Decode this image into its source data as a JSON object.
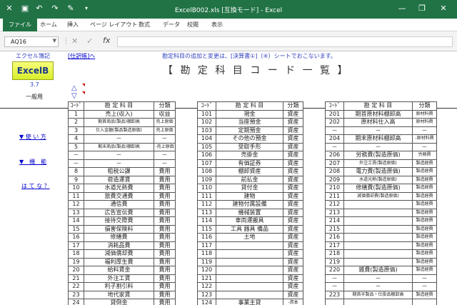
{
  "app": {
    "title": "ExcelB002.xls [互換モード] - Excel",
    "quick_access": {
      "undo": "↶",
      "redo": "↷",
      "brush": "✎"
    },
    "window": {
      "minimize": "—",
      "restore": "❐",
      "close": "✕"
    }
  },
  "ribbon": {
    "tabs": [
      "ファイル",
      "ホーム",
      "挿入",
      "ページ レイアウト",
      "数式",
      "データ",
      "校閲",
      "表示"
    ]
  },
  "formula_bar": {
    "name_box": "AQ16",
    "cancel": "✕",
    "enter": "✓",
    "fx": "fx",
    "value": ""
  },
  "sheet": {
    "top_link": "[仕訳帳]へ",
    "notice": "勘定科目の追加と変更は、[決算書①]（④）シートでおこないます。",
    "brand": "エクセル簿記",
    "logo": "ExcelB",
    "version": "3.7",
    "edition": "一般用",
    "title": "【 勘 定 科 目 コ ー ド 一 覧 】",
    "up_arrow": "△",
    "down_arrow": "▽",
    "side_links": [
      "▼ 使 い 方",
      "▼　機　能",
      "は て な ？"
    ],
    "headers": {
      "code": "ｺｰﾄﾞ",
      "name": "勘 定 科 目",
      "cat": "分類"
    },
    "table1": [
      [
        "1",
        "売上(収入)",
        "収益"
      ],
      [
        "2",
        "期首商品(製品)棚卸高",
        "売上原価"
      ],
      [
        "3",
        "仕入金額(製品製造原価)",
        "売上原価"
      ],
      [
        "4",
        "－",
        "－"
      ],
      [
        "5",
        "期末商品(製品)棚卸高",
        "-売上原価"
      ],
      [
        "－",
        "－",
        "－"
      ],
      [
        "－",
        "－",
        "－"
      ],
      [
        "8",
        "租税公課",
        "費用"
      ],
      [
        "9",
        "荷造運賃",
        "費用"
      ],
      [
        "10",
        "水道光熱費",
        "費用"
      ],
      [
        "11",
        "旅費交通費",
        "費用"
      ],
      [
        "12",
        "通信費",
        "費用"
      ],
      [
        "13",
        "広告宣伝費",
        "費用"
      ],
      [
        "14",
        "接待交際費",
        "費用"
      ],
      [
        "15",
        "損害保険料",
        "費用"
      ],
      [
        "16",
        "修繕費",
        "費用"
      ],
      [
        "17",
        "消耗品費",
        "費用"
      ],
      [
        "18",
        "減価償却費",
        "費用"
      ],
      [
        "19",
        "福利厚生費",
        "費用"
      ],
      [
        "20",
        "給料賃金",
        "費用"
      ],
      [
        "21",
        "外注工賃",
        "費用"
      ],
      [
        "22",
        "利子割引料",
        "費用"
      ],
      [
        "23",
        "地代家賃",
        "費用"
      ],
      [
        "24",
        "貸倒金",
        "費用"
      ]
    ],
    "table2": [
      [
        "101",
        "現金",
        "資産"
      ],
      [
        "102",
        "当座預金",
        "資産"
      ],
      [
        "103",
        "定期預金",
        "資産"
      ],
      [
        "104",
        "その他の預金",
        "資産"
      ],
      [
        "105",
        "受取手形",
        "資産"
      ],
      [
        "106",
        "売掛金",
        "資産"
      ],
      [
        "107",
        "有価証券",
        "資産"
      ],
      [
        "108",
        "棚卸資産",
        "資産"
      ],
      [
        "109",
        "前払金",
        "資産"
      ],
      [
        "110",
        "貸付金",
        "資産"
      ],
      [
        "111",
        "建物",
        "資産"
      ],
      [
        "112",
        "建物付属設備",
        "資産"
      ],
      [
        "113",
        "機械装置",
        "資産"
      ],
      [
        "114",
        "車両運搬具",
        "資産"
      ],
      [
        "115",
        "工具 器具 備品",
        "資産"
      ],
      [
        "116",
        "土地",
        "資産"
      ],
      [
        "117",
        "",
        "資産"
      ],
      [
        "118",
        "",
        "資産"
      ],
      [
        "119",
        "",
        "資産"
      ],
      [
        "120",
        "",
        "資産"
      ],
      [
        "121",
        "",
        "資産"
      ],
      [
        "122",
        "",
        "資産"
      ],
      [
        "123",
        "",
        "資産"
      ],
      [
        "124",
        "事業主貸",
        "-資本"
      ]
    ],
    "table3": [
      [
        "201",
        "期首原材料棚卸高",
        "原材料費"
      ],
      [
        "202",
        "原材料仕入高",
        "原材料費"
      ],
      [
        "－",
        "－",
        "－"
      ],
      [
        "204",
        "期末原材料棚卸高",
        "-原材料費"
      ],
      [
        "－",
        "－",
        "－"
      ],
      [
        "206",
        "労務費(製造原価)",
        "労務費"
      ],
      [
        "207",
        "外注工賃(製造原価)",
        "製造経費"
      ],
      [
        "208",
        "電力費(製造原価)",
        "製造経費"
      ],
      [
        "209",
        "水道光熱(製造原価)",
        "製造経費"
      ],
      [
        "210",
        "修繕費(製造原価)",
        "製造経費"
      ],
      [
        "211",
        "減価償却費(製造原価)",
        "製造経費"
      ],
      [
        "212",
        "",
        "製造経費"
      ],
      [
        "213",
        "",
        "製造経費"
      ],
      [
        "214",
        "",
        "製造経費"
      ],
      [
        "215",
        "",
        "製造経費"
      ],
      [
        "216",
        "",
        "製造経費"
      ],
      [
        "217",
        "",
        "製造経費"
      ],
      [
        "218",
        "",
        "製造経費"
      ],
      [
        "219",
        "",
        "製造経費"
      ],
      [
        "220",
        "雑費(製造原価)",
        "製造経費"
      ],
      [
        "－",
        "－",
        "－"
      ],
      [
        "－",
        "－",
        "－"
      ],
      [
        "223",
        "期首半製品・仕掛品棚卸高",
        "製造経費"
      ],
      [
        "",
        "",
        ""
      ]
    ]
  }
}
